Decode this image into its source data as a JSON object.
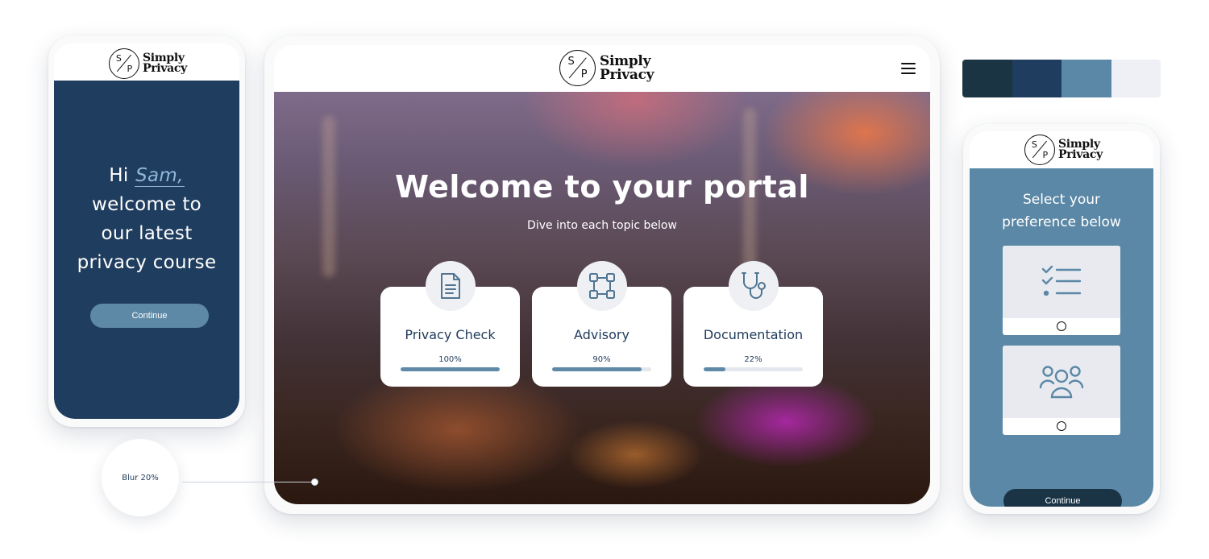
{
  "brand": {
    "mark_s": "S",
    "mark_p": "P",
    "line1": "Simply",
    "line2": "Privacy"
  },
  "phone_left": {
    "greeting_hi": "Hi",
    "user_name": "Sam,",
    "greeting_rest": [
      "welcome to",
      "our latest",
      "privacy course"
    ],
    "continue_label": "Continue"
  },
  "tablet": {
    "menu_icon": "hamburger-icon",
    "title": "Welcome to your portal",
    "subtitle": "Dive into each topic below",
    "cards": [
      {
        "icon": "document-icon",
        "title": "Privacy Check",
        "percent_label": "100%",
        "progress": 1.0
      },
      {
        "icon": "vector-square-icon",
        "title": "Advisory",
        "percent_label": "90%",
        "progress": 0.9
      },
      {
        "icon": "stethoscope-icon",
        "title": "Documentation",
        "percent_label": "22%",
        "progress": 0.22
      }
    ]
  },
  "blur_control": {
    "label": "Blur 20%"
  },
  "palette": [
    "#1b3444",
    "#1f3d5e",
    "#5b88a6",
    "#eef0f5"
  ],
  "phone_right": {
    "title_line1": "Select your",
    "title_line2": "preference below",
    "options": [
      {
        "icon": "checklist-icon"
      },
      {
        "icon": "group-icon"
      }
    ],
    "continue_label": "Continue"
  }
}
